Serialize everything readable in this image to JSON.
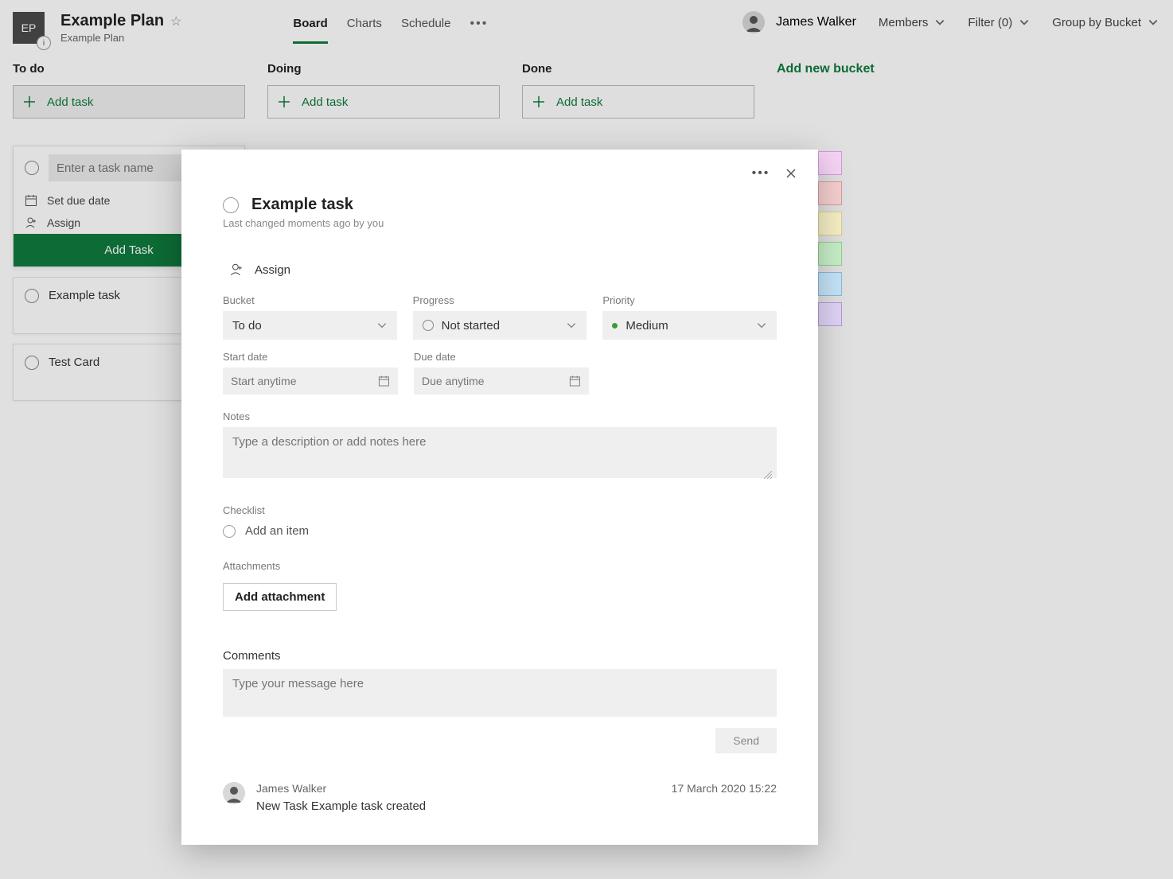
{
  "header": {
    "plan_initials": "EP",
    "plan_title": "Example Plan",
    "plan_sub": "Example Plan",
    "info_badge": "i",
    "tabs": [
      "Board",
      "Charts",
      "Schedule"
    ],
    "active_tab": "Board",
    "user_name": "James Walker",
    "members_label": "Members",
    "filter_label": "Filter (0)",
    "group_label": "Group by Bucket"
  },
  "board": {
    "columns": [
      {
        "title": "To do",
        "add_label": "Add task"
      },
      {
        "title": "Doing",
        "add_label": "Add task"
      },
      {
        "title": "Done",
        "add_label": "Add task"
      }
    ],
    "add_bucket_label": "Add new bucket",
    "new_task": {
      "placeholder": "Enter a task name",
      "due_label": "Set due date",
      "assign_label": "Assign",
      "submit": "Add Task"
    },
    "cards": [
      {
        "title": "Example task"
      },
      {
        "title": "Test Card"
      }
    ]
  },
  "swatches": [
    "#f6d3f6",
    "#f6cfcf",
    "#f6efc4",
    "#c7efc7",
    "#c5e3f8",
    "#e0d3f5"
  ],
  "dialog": {
    "title": "Example task",
    "subtitle": "Last changed moments ago by you",
    "assign_label": "Assign",
    "fields": {
      "bucket_label": "Bucket",
      "bucket_value": "To do",
      "progress_label": "Progress",
      "progress_value": "Not started",
      "priority_label": "Priority",
      "priority_value": "Medium",
      "start_label": "Start date",
      "start_ph": "Start anytime",
      "due_label": "Due date",
      "due_ph": "Due anytime",
      "notes_label": "Notes",
      "notes_ph": "Type a description or add notes here",
      "checklist_label": "Checklist",
      "checklist_add": "Add an item",
      "attach_label": "Attachments",
      "attach_btn": "Add attachment",
      "comments_label": "Comments",
      "comment_ph": "Type your message here",
      "send_label": "Send"
    },
    "activity": {
      "author": "James Walker",
      "timestamp": "17 March 2020 15:22",
      "text": "New Task Example task created"
    }
  }
}
